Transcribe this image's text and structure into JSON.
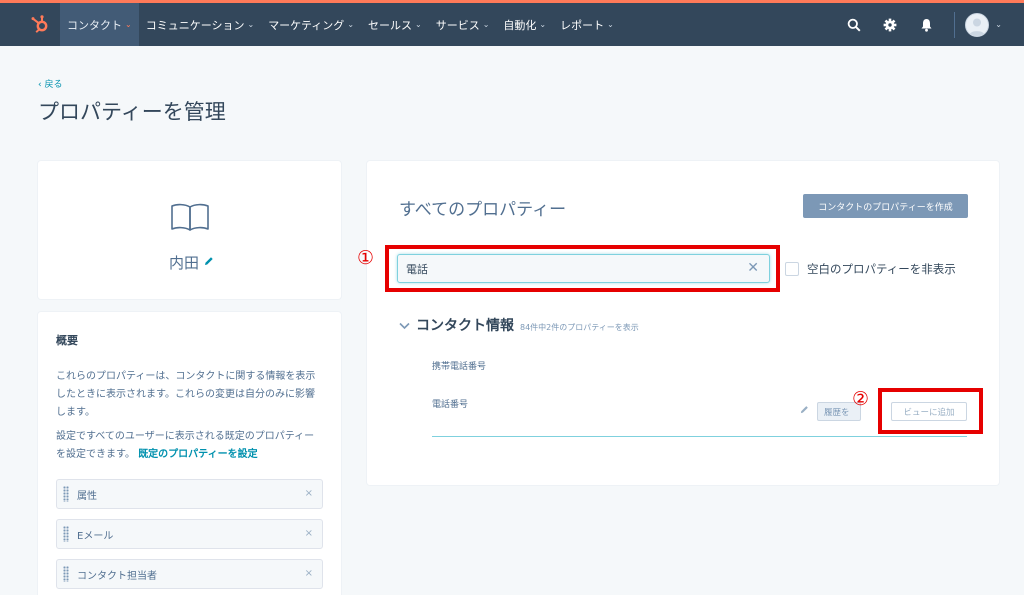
{
  "nav": {
    "items": [
      {
        "label": "コンタクト",
        "active": true
      },
      {
        "label": "コミュニケーション",
        "active": false
      },
      {
        "label": "マーケティング",
        "active": false
      },
      {
        "label": "セールス",
        "active": false
      },
      {
        "label": "サービス",
        "active": false
      },
      {
        "label": "自動化",
        "active": false
      },
      {
        "label": "レポート",
        "active": false
      }
    ],
    "chevron": "⌄",
    "icons": [
      "search-icon",
      "gear-icon",
      "bell-icon",
      "avatar"
    ]
  },
  "header": {
    "back_label": "‹  戻る",
    "title": "プロパティーを管理"
  },
  "profile": {
    "name": "内田",
    "icon": "book-icon"
  },
  "summary": {
    "title": "概要",
    "paragraph1": "これらのプロパティーは、コンタクトに関する情報を表示したときに表示されます。これらの変更は自分のみに影響します。",
    "paragraph2_text": "設定ですべてのユーザーに表示される既定のプロパティーを設定できます。",
    "paragraph2_link": "既定のプロパティーを設定",
    "groups": [
      "属性",
      "Eメール",
      "コンタクト担当者"
    ],
    "remove_symbol": "×"
  },
  "main": {
    "title": "すべてのプロパティー",
    "create_button": "コンタクトのプロパティーを作成",
    "search_value": "電話",
    "clear_symbol": "✕",
    "hide_empty_label": "空白のプロパティーを非表示",
    "group": {
      "title": "コンタクト情報",
      "count_text": "84件中2件のプロパティーを表示",
      "properties": [
        {
          "label": "携帯電話番号"
        },
        {
          "label": "電話番号",
          "history_button": "履歴を",
          "add_view_button": "ビューに追加"
        }
      ]
    }
  },
  "annotations": {
    "marker1": "①",
    "marker2": "②",
    "color": "#e60000"
  },
  "colors": {
    "nav_bg": "#33475b",
    "accent": "#ff7a59",
    "link": "#0091ae",
    "page_bg": "#f5f8fa"
  }
}
